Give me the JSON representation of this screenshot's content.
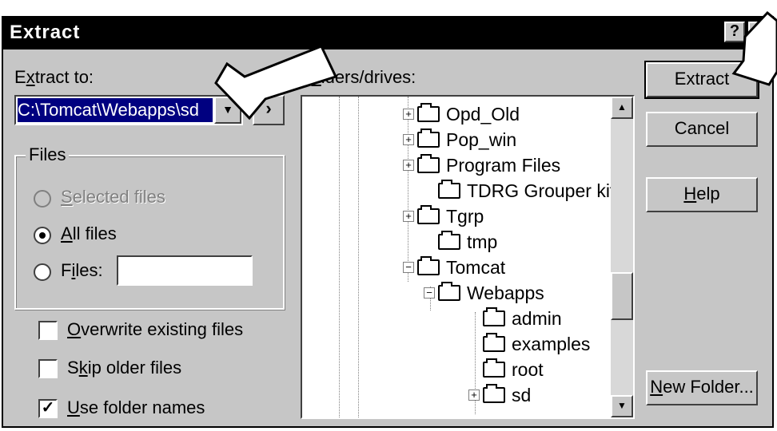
{
  "window": {
    "title": "Extract"
  },
  "titlebar": {
    "help_label": "?",
    "close_label": "✕"
  },
  "extract_to": {
    "label_pre": "E",
    "label_u": "x",
    "label_post": "tract to:",
    "path_value": "C:\\Tomcat\\Webapps\\sd",
    "dropdown_glyph": "▼",
    "browse_glyph": "›"
  },
  "folders": {
    "label_pre": "F",
    "label_u": "o",
    "label_post": "lders/drives:",
    "items": [
      {
        "name": "Opd_Old",
        "expander": "+"
      },
      {
        "name": "Pop_win",
        "expander": "+"
      },
      {
        "name": "Program Files",
        "expander": "+"
      },
      {
        "name": "TDRG Grouper kit",
        "expander": ""
      },
      {
        "name": "Tgrp",
        "expander": "+"
      },
      {
        "name": "tmp",
        "expander": ""
      },
      {
        "name": "Tomcat",
        "expander": "−"
      },
      {
        "name": "Webapps",
        "expander": "−"
      },
      {
        "name": "admin",
        "expander": ""
      },
      {
        "name": "examples",
        "expander": ""
      },
      {
        "name": "root",
        "expander": ""
      },
      {
        "name": "sd",
        "expander": "+"
      }
    ]
  },
  "files_group": {
    "label": "Files",
    "selected": {
      "pre": "",
      "u": "S",
      "post": "elected files"
    },
    "all": {
      "pre": "",
      "u": "A",
      "post": "ll files"
    },
    "files": {
      "pre": "F",
      "u": "i",
      "post": "les:"
    },
    "files_value": ""
  },
  "options": {
    "overwrite": {
      "pre": "",
      "u": "O",
      "post": "verwrite existing files",
      "checked_glyph": ""
    },
    "skip_older": {
      "pre": "S",
      "u": "k",
      "post": "ip older files",
      "checked_glyph": ""
    },
    "use_folder_names": {
      "pre": "",
      "u": "U",
      "post": "se folder names",
      "checked_glyph": "✓"
    }
  },
  "buttons": {
    "extract": "Extract",
    "cancel": "Cancel",
    "help_pre": "",
    "help_u": "H",
    "help_post": "elp",
    "new_folder_pre": "",
    "new_folder_u": "N",
    "new_folder_post": "ew Folder..."
  },
  "scroll": {
    "up_glyph": "▲",
    "down_glyph": "▼"
  },
  "colors": {
    "selection": "#000080",
    "dialog_face": "#c6c6c6"
  }
}
